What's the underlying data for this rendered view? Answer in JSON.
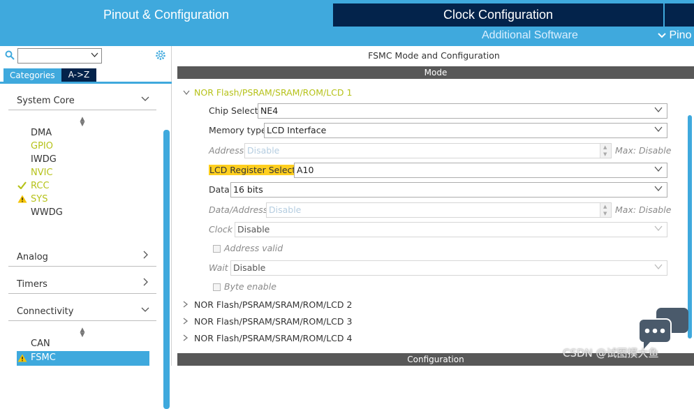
{
  "top_tabs": {
    "pinout": "Pinout & Configuration",
    "clock": "Clock Configuration"
  },
  "sub_bar": {
    "additional": "Additional Software",
    "pinout_dropdown": "Pino"
  },
  "left_panel": {
    "search": {
      "value": ""
    },
    "tabs": {
      "categories": "Categories",
      "az": "A->Z"
    },
    "groups": {
      "system_core": {
        "label": "System Core",
        "items": [
          {
            "label": "DMA",
            "status": "none"
          },
          {
            "label": "GPIO",
            "status": "enabled"
          },
          {
            "label": "IWDG",
            "status": "none"
          },
          {
            "label": "NVIC",
            "status": "enabled"
          },
          {
            "label": "RCC",
            "status": "ok"
          },
          {
            "label": "SYS",
            "status": "warning"
          },
          {
            "label": "WWDG",
            "status": "none"
          }
        ]
      },
      "analog": {
        "label": "Analog"
      },
      "timers": {
        "label": "Timers"
      },
      "connectivity": {
        "label": "Connectivity",
        "items": [
          {
            "label": "CAN",
            "status": "none"
          },
          {
            "label": "FSMC",
            "status": "warning-selected"
          }
        ]
      }
    }
  },
  "right_panel": {
    "title": "FSMC Mode and Configuration",
    "mode_header": "Mode",
    "config_header": "Configuration",
    "sections": [
      "NOR Flash/PSRAM/SRAM/ROM/LCD 1",
      "NOR Flash/PSRAM/SRAM/ROM/LCD 2",
      "NOR Flash/PSRAM/SRAM/ROM/LCD 3",
      "NOR Flash/PSRAM/SRAM/ROM/LCD 4"
    ],
    "fields": {
      "chip_select": {
        "label": "Chip Select",
        "value": "NE4"
      },
      "memory_type": {
        "label": "Memory type",
        "value": "LCD Interface"
      },
      "address": {
        "label": "Address",
        "value": "Disable",
        "max": "Max: Disable"
      },
      "lcd_register_select": {
        "label": "LCD Register Select",
        "value": "A10"
      },
      "data": {
        "label": "Data",
        "value": "16 bits"
      },
      "data_address": {
        "label": "Data/Address",
        "value": "Disable",
        "max": "Max: Disable"
      },
      "clock": {
        "label": "Clock",
        "value": "Disable"
      },
      "address_valid": {
        "label": "Address valid",
        "checked": false
      },
      "wait": {
        "label": "Wait",
        "value": "Disable"
      },
      "byte_enable": {
        "label": "Byte enable",
        "checked": false
      }
    }
  },
  "watermark": "CSDN @试图摸大鱼",
  "colors": {
    "accent_blue": "#3fa9dd",
    "navy": "#03234b",
    "header_gray": "#585858",
    "enabled_green": "#b6c21a",
    "highlight_yellow": "#ffcf1f",
    "warning_yellow": "#f5c400"
  }
}
